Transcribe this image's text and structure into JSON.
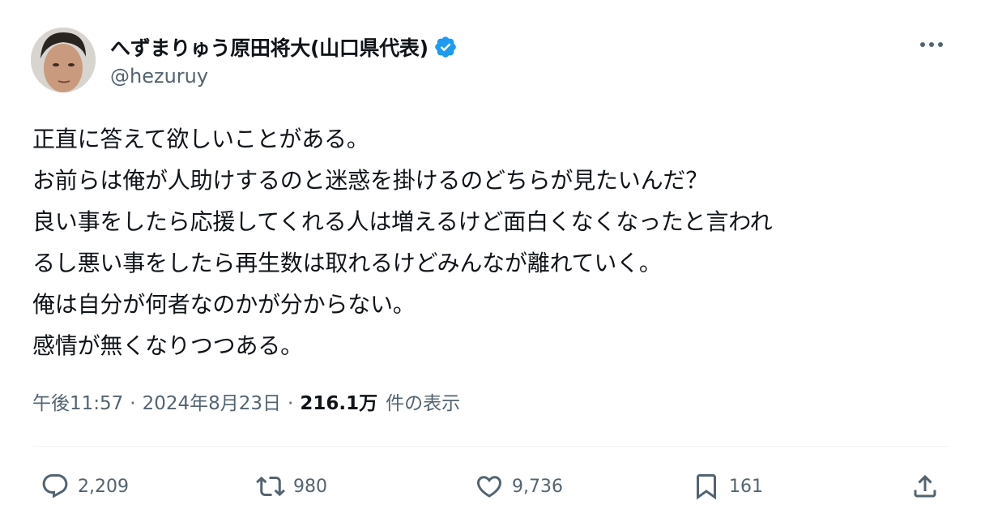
{
  "author": {
    "display_name": "へずまりゅう原田将大(山口県代表)",
    "handle": "@hezuruy",
    "verified_color": "#1d9bf0"
  },
  "post": {
    "lines": [
      "正直に答えて欲しいことがある。",
      "お前らは俺が人助けするのと迷惑を掛けるのどちらが見たいんだ？",
      "良い事をしたら応援してくれる人は増えるけど面白くなくなったと言われ",
      "るし悪い事をしたら再生数は取れるけどみんなが離れていく。",
      "俺は自分が何者なのかが分からない。",
      "感情が無くなりつつある。"
    ],
    "time": "午後11:57",
    "separator": "·",
    "date": "2024年8月23日",
    "views_count": "216.1万",
    "views_label": "件の表示"
  },
  "actions": {
    "reply_count": "2,209",
    "repost_count": "980",
    "like_count": "9,736",
    "bookmark_count": "161"
  },
  "icons": {
    "more": "more-horizontal-icon",
    "reply": "reply-icon",
    "repost": "repost-icon",
    "like": "heart-icon",
    "bookmark": "bookmark-icon",
    "share": "share-icon"
  },
  "colors": {
    "text": "#0f1419",
    "secondary": "#536471",
    "verified": "#1d9bf0"
  }
}
